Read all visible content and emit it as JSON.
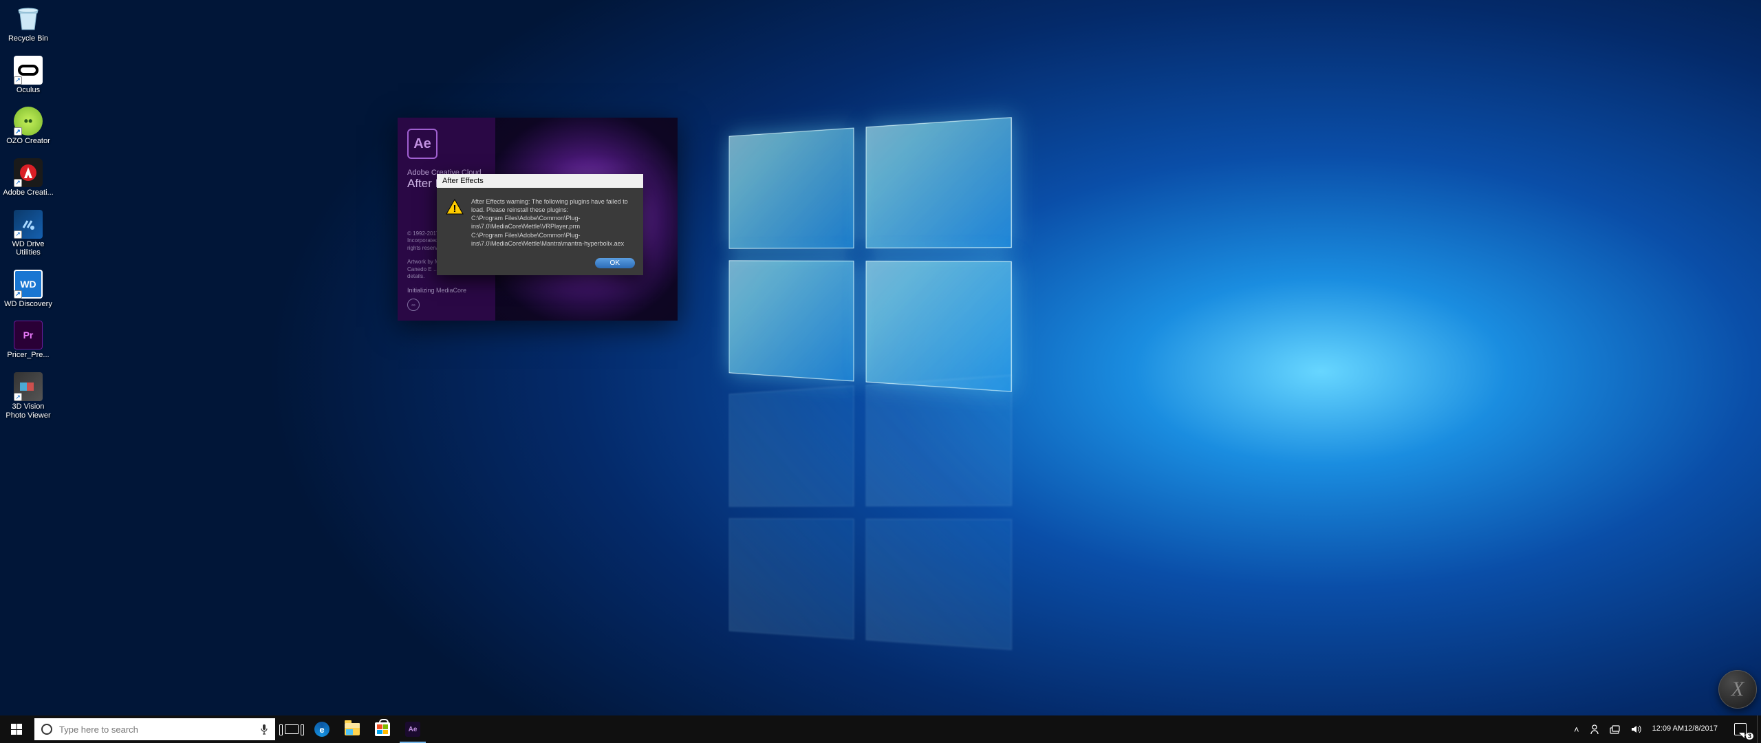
{
  "desktop": {
    "icons": [
      {
        "id": "recycle-bin",
        "label": "Recycle Bin",
        "shortcut": false
      },
      {
        "id": "oculus",
        "label": "Oculus",
        "shortcut": true
      },
      {
        "id": "ozo-creator",
        "label": "OZO Creator",
        "shortcut": true
      },
      {
        "id": "adobe-cc",
        "label": "Adobe Creati...",
        "shortcut": true
      },
      {
        "id": "wd-utilities",
        "label": "WD Drive Utilities",
        "shortcut": true
      },
      {
        "id": "wd-discovery",
        "label": "WD Discovery",
        "shortcut": true
      },
      {
        "id": "pricer-pre",
        "label": "Pricer_Pre...",
        "shortcut": false
      },
      {
        "id": "3d-vision",
        "label": "3D Vision Photo Viewer",
        "shortcut": true
      }
    ]
  },
  "splash": {
    "app_icon_text": "Ae",
    "line1": "Adobe Creative Cloud",
    "line2": "After Effects CC",
    "copyright": "© 1992-2017 Adobe Systems Incorporated and its licensors. All rights reserved.",
    "artwork": "Artwork by Mitch … Jorge R. Canedo E … See About Screen for details.",
    "init": "Initializing MediaCore",
    "cc_glyph": "∞"
  },
  "dialog": {
    "title": "After Effects",
    "message_intro": "After Effects warning: The following plugins have failed to load. Please reinstall these plugins:",
    "paths": [
      "C:\\Program Files\\Adobe\\Common\\Plug-ins\\7.0\\MediaCore\\Mettle\\VRPlayer.prm",
      "C:\\Program Files\\Adobe\\Common\\Plug-ins\\7.0\\MediaCore\\Mettle\\Mantra\\mantra-hyperbolix.aex"
    ],
    "ok_label": "OK"
  },
  "circle_app": {
    "glyph": "X"
  },
  "taskbar": {
    "search_placeholder": "Type here to search",
    "pinned": [
      {
        "id": "task-view",
        "name": "Task View"
      },
      {
        "id": "edge",
        "name": "Microsoft Edge",
        "glyph": "e"
      },
      {
        "id": "file-explorer",
        "name": "File Explorer"
      },
      {
        "id": "ms-store",
        "name": "Microsoft Store"
      },
      {
        "id": "after-effects",
        "name": "After Effects",
        "glyph": "Ae",
        "active": true
      }
    ],
    "tray": {
      "up_arrow": "˄",
      "people": "👤",
      "network": "📶",
      "volume": "🔊",
      "time": "12:09 AM",
      "date": "12/8/2017",
      "notif_count": "3"
    }
  }
}
